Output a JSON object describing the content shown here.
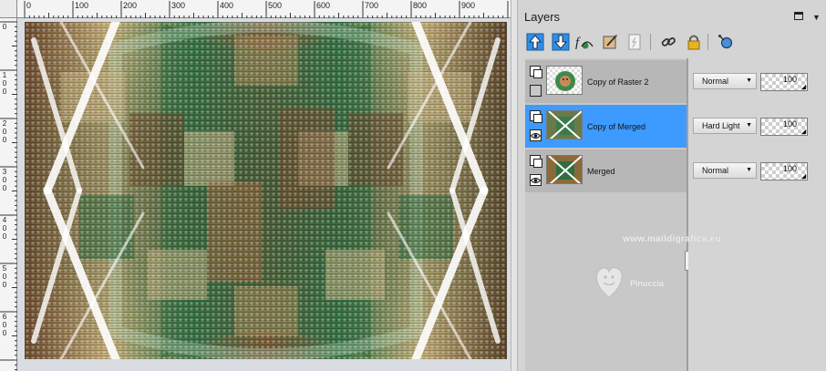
{
  "rulers": {
    "horizontal": [
      "0",
      "100",
      "200",
      "300",
      "400",
      "500",
      "600",
      "700",
      "800",
      "900"
    ],
    "vertical": [
      "0",
      "100",
      "200",
      "300",
      "400",
      "500",
      "600"
    ]
  },
  "palette": {
    "title": "Layers",
    "toolbar_icons": [
      "move-layer-up-icon",
      "move-layer-down-icon",
      "layer-styles-icon",
      "edit-selection-icon",
      "properties-icon",
      "link-icon",
      "lock-icon",
      "lasso-icon"
    ]
  },
  "layers": [
    {
      "name": "Copy of Raster 2",
      "blend_mode": "Normal",
      "opacity": "100",
      "visible": false,
      "selected": false
    },
    {
      "name": "Copy of Merged",
      "blend_mode": "Hard Light",
      "opacity": "100",
      "visible": true,
      "selected": true
    },
    {
      "name": "Merged",
      "blend_mode": "Normal",
      "opacity": "100",
      "visible": true,
      "selected": false
    }
  ],
  "watermark": {
    "line1": "Pinuccia",
    "line2": "www.maildigrafica.eu"
  },
  "colors": {
    "selected_row": "#3d9bff",
    "palette_bg": "#d4d4d4",
    "layer_row_bg": "#b7b7b7"
  }
}
